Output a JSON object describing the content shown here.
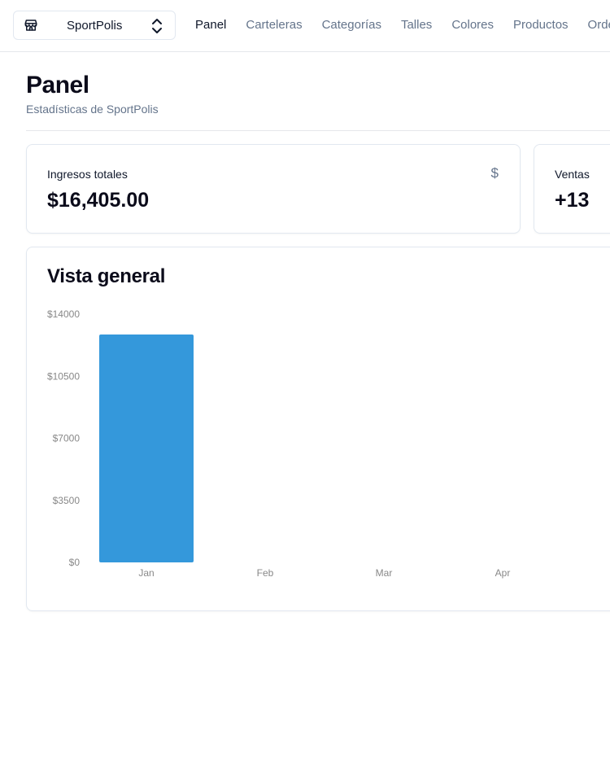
{
  "store": {
    "name": "SportPolis",
    "icon": "store-icon",
    "switch_icon": "chevrons-up-down-icon"
  },
  "nav": {
    "items": [
      {
        "label": "Panel",
        "active": true
      },
      {
        "label": "Carteleras",
        "active": false
      },
      {
        "label": "Categorías",
        "active": false
      },
      {
        "label": "Talles",
        "active": false
      },
      {
        "label": "Colores",
        "active": false
      },
      {
        "label": "Productos",
        "active": false
      },
      {
        "label": "Ordenes",
        "active": false
      }
    ]
  },
  "header": {
    "title": "Panel",
    "subtitle": "Estadísticas de SportPolis"
  },
  "cards": {
    "revenue": {
      "label": "Ingresos totales",
      "value": "$16,405.00",
      "icon": "dollar-icon",
      "icon_glyph": "$"
    },
    "sales": {
      "label": "Ventas",
      "value": "+13"
    }
  },
  "overview": {
    "title": "Vista general"
  },
  "chart_data": {
    "type": "bar",
    "categories": [
      "Jan",
      "Feb",
      "Mar",
      "Apr"
    ],
    "values": [
      12850,
      0,
      0,
      0
    ],
    "yticks": [
      "$0",
      "$3500",
      "$7000",
      "$10500",
      "$14000"
    ],
    "ylim": [
      0,
      14000
    ],
    "bar_color": "#3498db",
    "grid": false
  },
  "colors": {
    "muted": "#64748b",
    "border": "#e2e8f0",
    "accent": "#3498db"
  }
}
